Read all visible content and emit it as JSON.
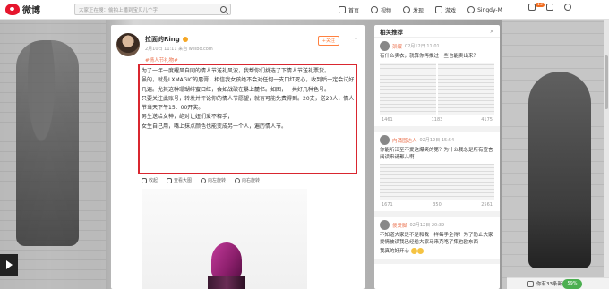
{
  "header": {
    "logo_text": "微博",
    "search_placeholder": "大家正在搜：偷拍上潘到宝贝儿个字",
    "nav": [
      {
        "label": "首页",
        "icon": "home-icon"
      },
      {
        "label": "视频",
        "icon": "video-icon"
      },
      {
        "label": "发现",
        "icon": "discover-icon"
      },
      {
        "label": "游戏",
        "icon": "game-icon"
      },
      {
        "label": "Singdy-M",
        "icon": "user-icon"
      }
    ],
    "badge": "13"
  },
  "post": {
    "username": "拉面的Ring",
    "meta": "2月10日 11:11 来自 weibo.com",
    "follow_label": "+关注",
    "tag": "#情人节礼物#",
    "body": [
      "为了一年一度耀风自同的情人节送礼风波，我帮你们挑选了下情人节送礼票货。",
      "虽的，就是LXMAGIC的唇膏，相信我女孩绝不会对任何一支口红死心，收到后一定会试好几遍。尤其这种珊瑚绯蜜口红，会如战破在暴上麓亿。如图，一共好几种色号。",
      "只要关注此账号，转发并评论你的情人节愿望，就有可能免费得到。20支，送20人，情人节当天下午15：00开奖。",
      "男生送给女神，绝对让妞们爱不释手；",
      "女生自己用，嘴上抹点颜色也能变成另一个人，遍历情人节。"
    ],
    "actions": [
      "收起",
      "查看大图",
      "向左旋转",
      "向右旋转"
    ]
  },
  "side": {
    "title": "相关推荐",
    "close": "×",
    "items": [
      {
        "name": "架爆",
        "time": "02月12日 11:01",
        "text": "有什么卖衣，就算你再推过一些也能卖出来？",
        "stats": [
          "1461",
          "1183",
          "4175"
        ]
      },
      {
        "name": "内诵图达人",
        "time": "02月12日 15:54",
        "text": "你能听江至不爱这爆笑的第？为什么我总是所有宣言阅读来请都入啊",
        "stats": [
          "1671",
          "350",
          "2561"
        ]
      },
      {
        "name": "傻爱脚",
        "time": "02月12日 20:39",
        "text": "不知道大家是不是和我一样每手全得！为了防止大家爱情被读我已经给大家马来克咯了集也欧东西",
        "extra": "我真的好开心"
      }
    ]
  },
  "chat": {
    "label": "你有33条新私信",
    "progress": "59%"
  }
}
